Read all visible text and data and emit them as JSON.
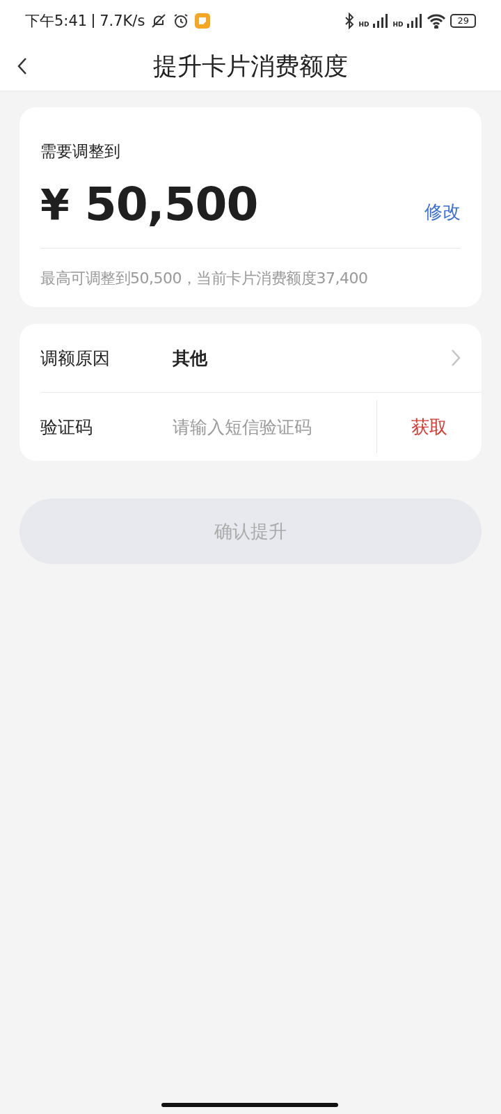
{
  "status_bar": {
    "time": "下午5:41",
    "speed": "7.7K/s",
    "signal_labels": [
      "HD",
      "HD"
    ],
    "battery": "29"
  },
  "nav": {
    "title": "提升卡片消费额度"
  },
  "amount_card": {
    "label": "需要调整到",
    "currency": "¥",
    "amount": "50,500",
    "edit": "修改",
    "note": "最高可调整到50,500，当前卡片消费额度37,400"
  },
  "form": {
    "reason": {
      "label": "调额原因",
      "value": "其他"
    },
    "code": {
      "label": "验证码",
      "placeholder": "请输入短信验证码",
      "action": "获取"
    }
  },
  "submit": {
    "label": "确认提升",
    "disabled": true
  }
}
